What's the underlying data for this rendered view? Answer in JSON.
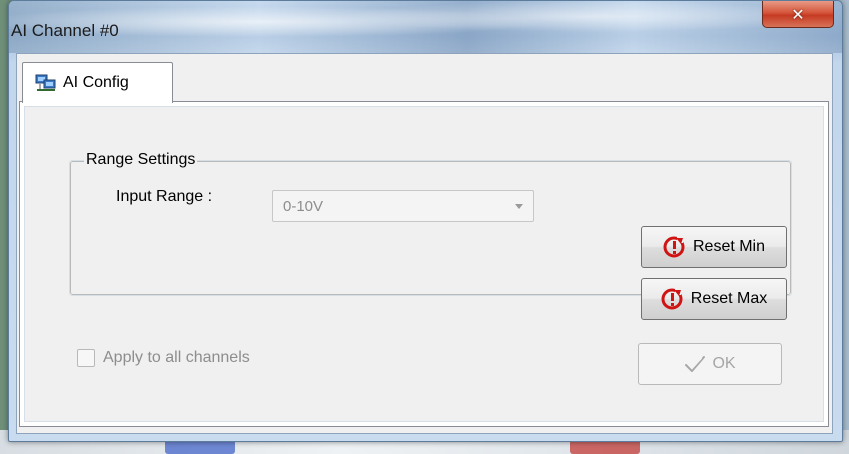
{
  "window": {
    "title": "AI Channel #0",
    "close_glyph": "✕"
  },
  "tabs": [
    {
      "label": "AI Config",
      "icon": "network-config-icon",
      "selected": true
    }
  ],
  "range_settings": {
    "group_title": "Range Settings",
    "input_range_label": "Input Range :",
    "input_range_value": "0-10V"
  },
  "buttons": {
    "reset_min": {
      "label": "Reset Min",
      "icon": "reset-icon"
    },
    "reset_max": {
      "label": "Reset Max",
      "icon": "reset-icon"
    },
    "ok": {
      "label": "OK",
      "icon": "checkmark-icon",
      "enabled": false
    }
  },
  "apply_all": {
    "label": "Apply to all channels",
    "checked": false,
    "enabled": false
  },
  "colors": {
    "reset_icon": "#d01414",
    "close_button": "#c53a22"
  }
}
